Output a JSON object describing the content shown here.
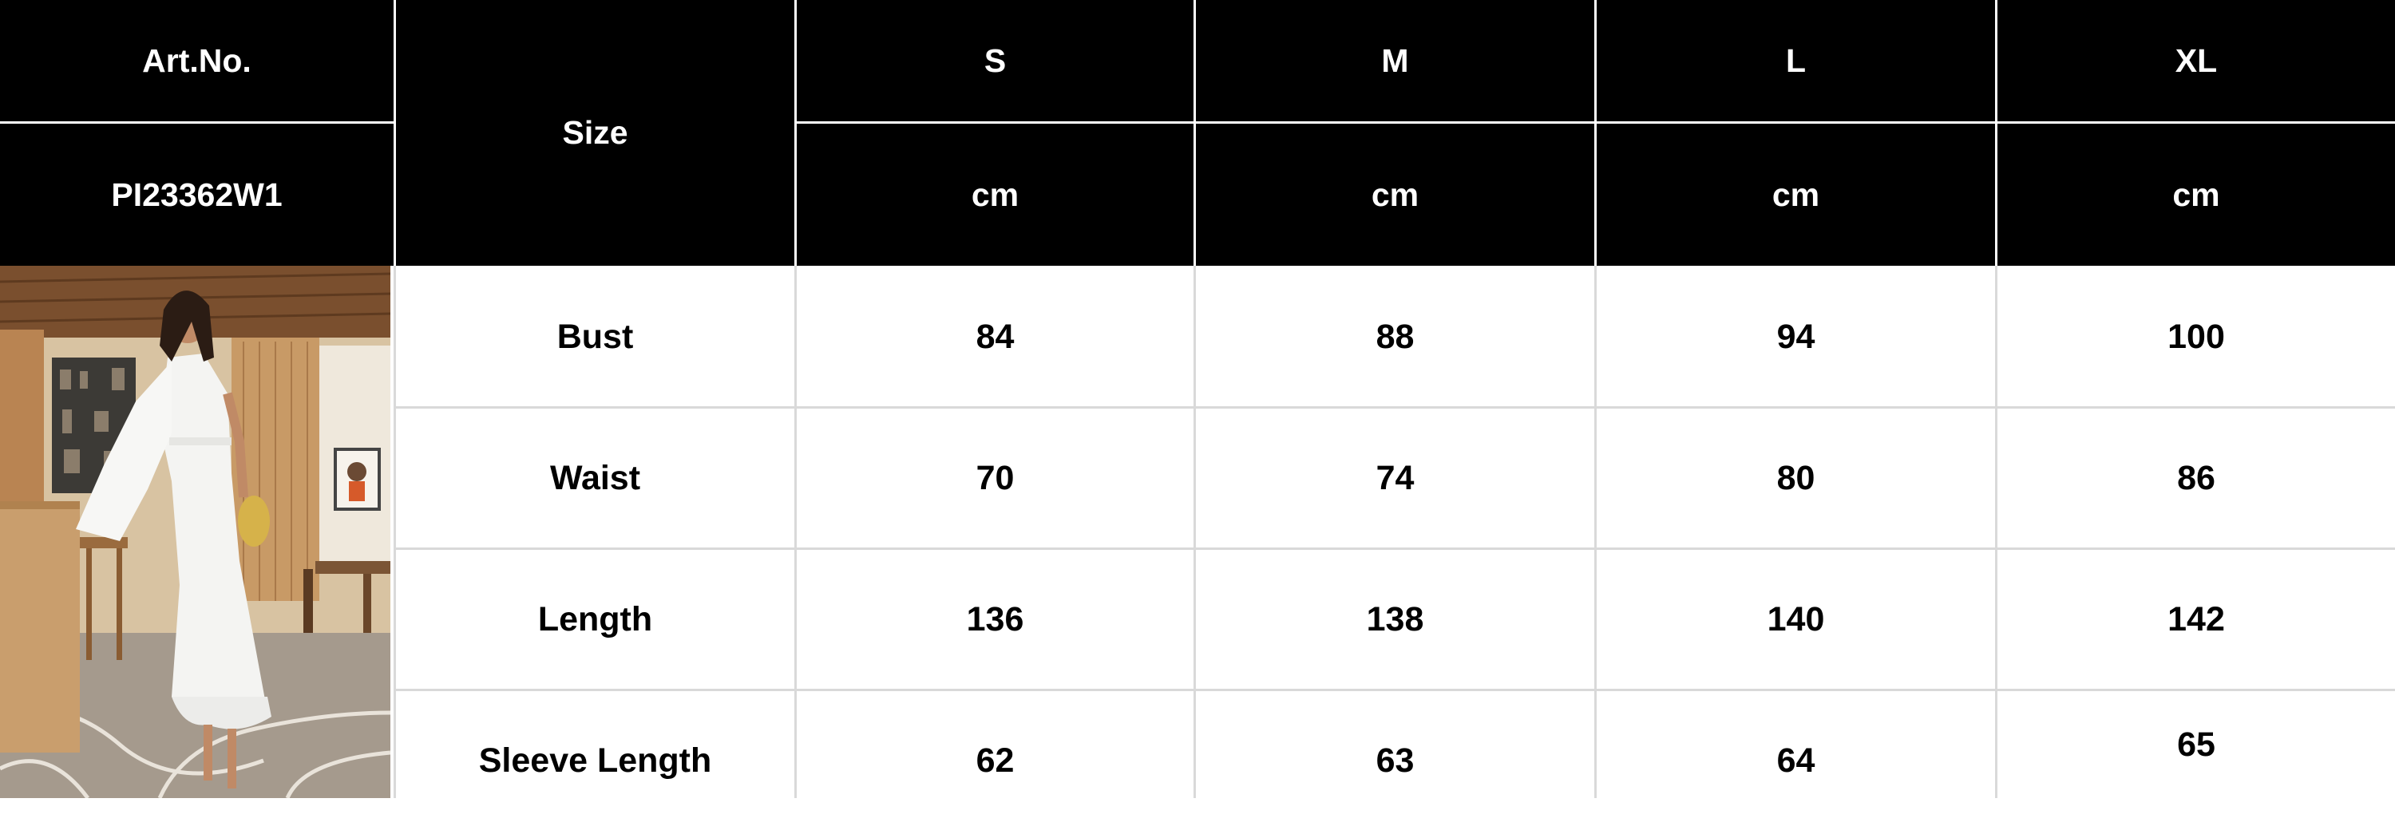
{
  "header": {
    "art_no_label": "Art.No.",
    "art_no_value": "PI23362W1",
    "size_label": "Size",
    "sizes": [
      "S",
      "M",
      "L",
      "XL"
    ],
    "unit": "cm"
  },
  "rows": [
    {
      "label": "Bust",
      "values": [
        "84",
        "88",
        "94",
        "100"
      ]
    },
    {
      "label": "Waist",
      "values": [
        "70",
        "74",
        "80",
        "86"
      ]
    },
    {
      "label": "Length",
      "values": [
        "136",
        "138",
        "140",
        "142"
      ]
    },
    {
      "label": "Sleeve Length",
      "values": [
        "62",
        "63",
        "64",
        "65"
      ]
    }
  ],
  "colors": {
    "header_bg": "#000000",
    "header_text": "#ffffff",
    "body_bg": "#ffffff",
    "body_text": "#000000",
    "grid": "#d9d9d9"
  },
  "photo": {
    "subject": "model-in-white-one-shoulder-dress"
  }
}
